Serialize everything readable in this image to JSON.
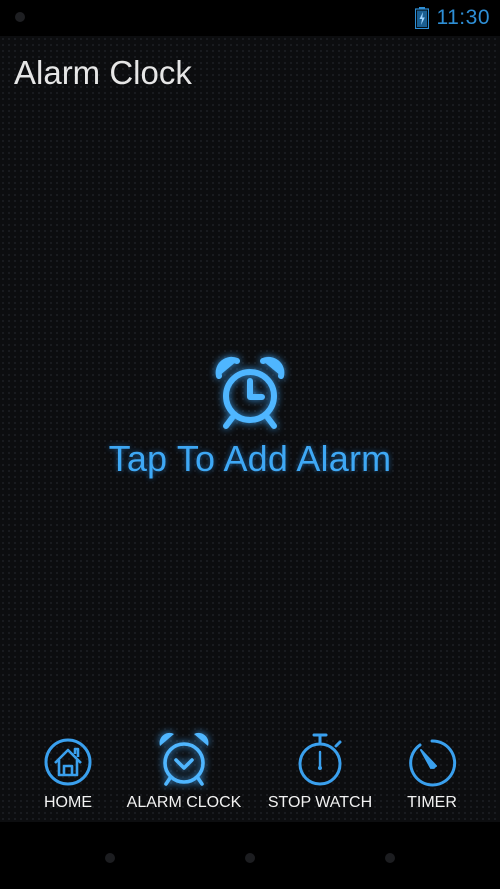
{
  "status_bar": {
    "time": "11:30",
    "icons": [
      "battery-charging-icon"
    ]
  },
  "header": {
    "title": "Alarm Clock"
  },
  "empty_state": {
    "icon": "alarm-clock-icon",
    "text": "Tap To Add Alarm"
  },
  "tabs": [
    {
      "label": "HOME",
      "icon": "home-icon",
      "active": false
    },
    {
      "label": "ALARM CLOCK",
      "icon": "alarm-clock-icon",
      "active": true
    },
    {
      "label": "STOP WATCH",
      "icon": "stopwatch-icon",
      "active": false
    },
    {
      "label": "TIMER",
      "icon": "timer-icon",
      "active": false
    }
  ],
  "colors": {
    "accent": "#3ea8f5",
    "background": "#0c0d0f",
    "status_time": "#2e8fd6"
  }
}
